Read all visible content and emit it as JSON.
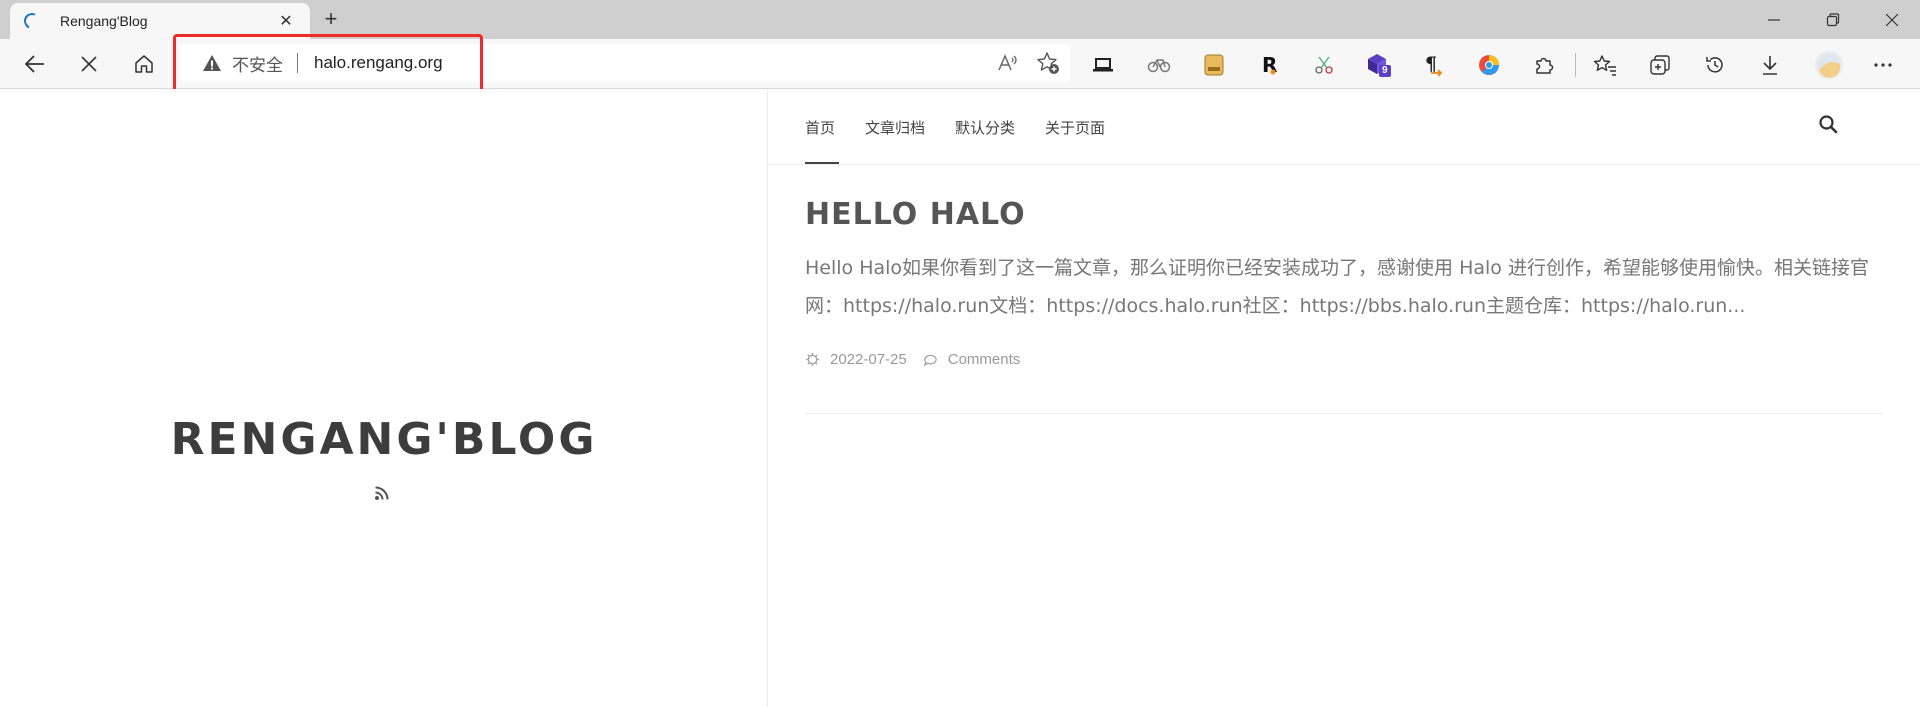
{
  "browser": {
    "tab": {
      "title": "Rengang'Blog",
      "loading": true
    },
    "address": {
      "security_label": "不安全",
      "url": "halo.rengang.org"
    },
    "icons": {
      "back": "arrow-left-icon",
      "stop": "close-icon",
      "home": "home-icon",
      "read_aloud": "read-aloud-icon",
      "add_favorite": "star-plus-icon",
      "extensions": [
        "laptop-icon",
        "bicycle-icon",
        "calculator-icon",
        "r-icon",
        "scissors-icon",
        "cube-badge-icon",
        "paragraph-icon",
        "edge-circle-icon",
        "puzzle-icon",
        "favorites-icon",
        "collections-icon",
        "history-icon",
        "download-icon",
        "profile-icon",
        "more-icon"
      ],
      "extension_badge": "9"
    },
    "highlight_color": "#ee2a2a"
  },
  "blog": {
    "site_title": "RENGANG'BLOG",
    "nav": [
      "首页",
      "文章归档",
      "默认分类",
      "关于页面"
    ],
    "active_nav": "首页",
    "post": {
      "title": "HELLO HALO",
      "excerpt": "Hello Halo如果你看到了这一篇文章，那么证明你已经安装成功了，感谢使用 Halo 进行创作，希望能够使用愉快。相关链接官网：https://halo.run文档：https://docs.halo.run社区：https://bbs.halo.run主题仓库：https://halo.run...",
      "date": "2022-07-25",
      "comments_label": "Comments"
    }
  }
}
